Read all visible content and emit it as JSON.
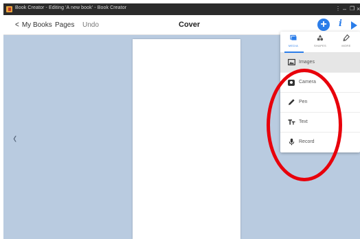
{
  "window": {
    "title": "Book Creator - Editing 'A new book' - Book Creator",
    "controls": {
      "menu": "⋮",
      "minimize": "–",
      "maximize": "❐",
      "close": "×"
    }
  },
  "toolbar": {
    "back_label": "My Books",
    "pages_label": "Pages",
    "undo_label": "Undo",
    "page_title": "Cover",
    "add_symbol": "+",
    "info_symbol": "i"
  },
  "canvas": {
    "prev_arrow": "‹"
  },
  "add_menu": {
    "tabs": [
      {
        "label": "MEDIA",
        "icon": "media-icon",
        "active": true
      },
      {
        "label": "SHAPES",
        "icon": "shapes-icon",
        "active": false
      },
      {
        "label": "MORE",
        "icon": "more-icon",
        "active": false
      }
    ],
    "items": [
      {
        "label": "Images",
        "icon": "image-icon",
        "selected": true
      },
      {
        "label": "Camera",
        "icon": "camera-icon",
        "selected": false
      },
      {
        "label": "Pen",
        "icon": "pen-icon",
        "selected": false
      },
      {
        "label": "Text",
        "icon": "text-icon",
        "selected": false
      },
      {
        "label": "Record",
        "icon": "microphone-icon",
        "selected": false
      }
    ]
  },
  "colors": {
    "accent": "#2b7de9",
    "canvas_background": "#b9cbe0",
    "annotation": "#e8000b"
  }
}
